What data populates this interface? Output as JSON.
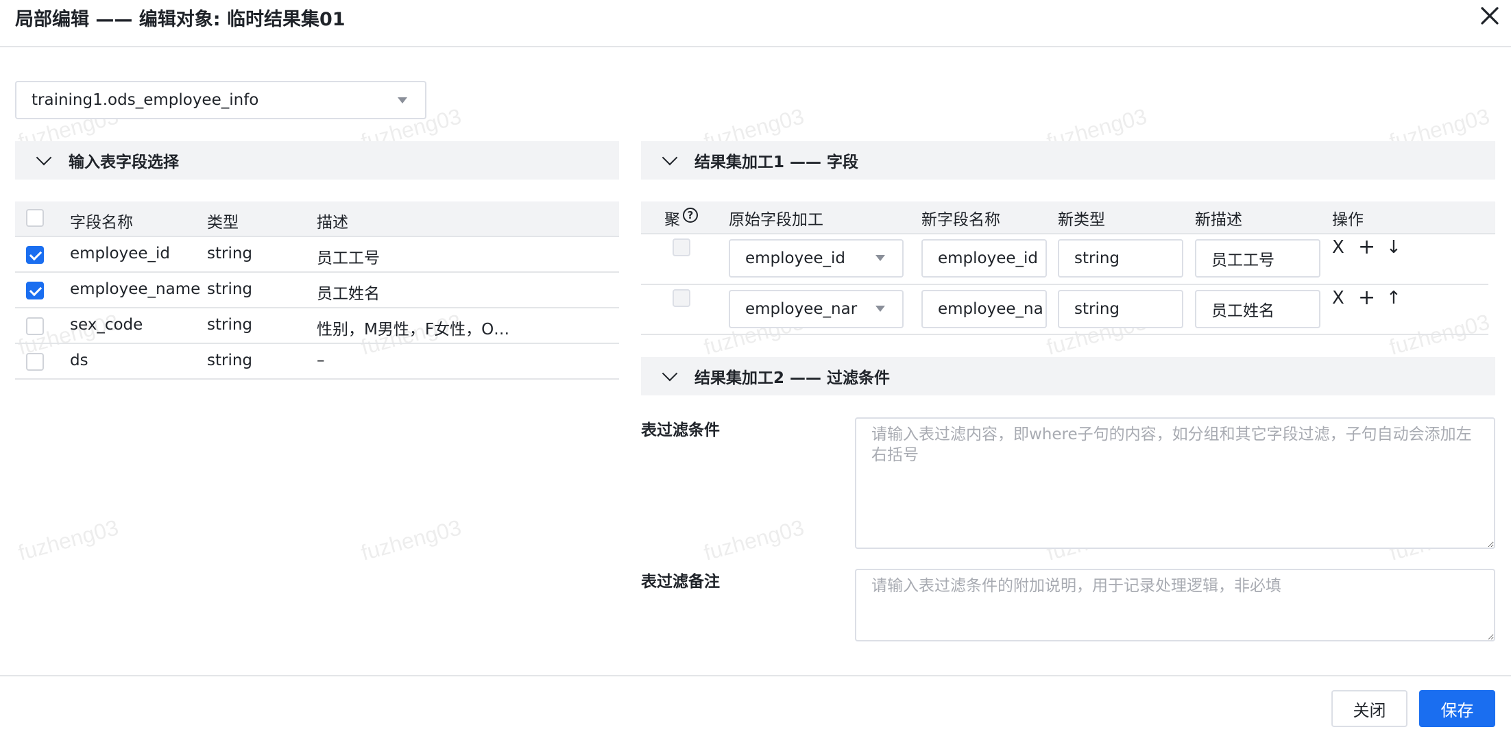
{
  "dialog": {
    "title": "局部编辑 —— 编辑对象: 临时结果集01"
  },
  "watermark": "fuzheng03",
  "table_select": {
    "value": "training1.ods_employee_info"
  },
  "input_panel": {
    "title": "输入表字段选择",
    "columns": [
      "字段名称",
      "类型",
      "描述"
    ],
    "rows": [
      {
        "name": "employee_id",
        "type": "string",
        "desc": "员工工号",
        "checked": true
      },
      {
        "name": "employee_name",
        "type": "string",
        "desc": "员工姓名",
        "checked": true
      },
      {
        "name": "sex_code",
        "type": "string",
        "desc": "性别，M男性，F女性，O…",
        "checked": false
      },
      {
        "name": "ds",
        "type": "string",
        "desc": "–",
        "checked": false
      }
    ]
  },
  "result_panel1": {
    "title": "结果集加工1 —— 字段",
    "columns": {
      "agg": "聚",
      "help": "?",
      "source": "原始字段加工",
      "new_name": "新字段名称",
      "new_type": "新类型",
      "new_desc": "新描述",
      "ops": "操作"
    },
    "rows": [
      {
        "source": "employee_id",
        "new_name": "employee_id",
        "new_type": "string",
        "new_desc": "员工工号",
        "move": "↓"
      },
      {
        "source": "employee_nar",
        "new_name": "employee_na",
        "new_type": "string",
        "new_desc": "员工姓名",
        "move": "↑"
      }
    ],
    "ops_labels": {
      "delete": "X",
      "add": "+"
    }
  },
  "result_panel2": {
    "title": "结果集加工2 —— 过滤条件",
    "filter_label": "表过滤条件",
    "filter_placeholder": "请输入表过滤内容，即where子句的内容，如分组和其它字段过滤，子句自动会添加左右括号",
    "note_label": "表过滤备注",
    "note_placeholder": "请输入表过滤条件的附加说明，用于记录处理逻辑，非必填"
  },
  "footer": {
    "close_label": "关闭",
    "save_label": "保存"
  },
  "colors": {
    "primary": "#1a6ef0",
    "panel_bg": "#f2f3f5",
    "border": "#dcdfe6"
  }
}
